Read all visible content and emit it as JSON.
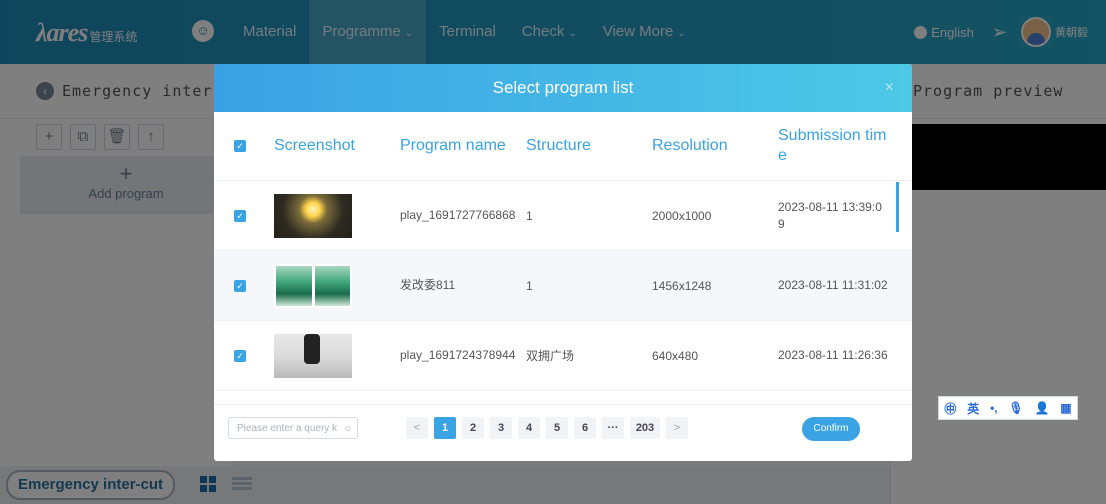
{
  "topbar": {
    "logo_main": "λares",
    "logo_sub": "管理系统",
    "nav": [
      {
        "label": "Material",
        "has_caret": false
      },
      {
        "label": "Programme",
        "has_caret": true
      },
      {
        "label": "Terminal",
        "has_caret": false
      },
      {
        "label": "Check",
        "has_caret": true
      },
      {
        "label": "View More",
        "has_caret": true
      }
    ],
    "language": "English",
    "username": "黄朝毅",
    "accent_color": "#1f8bb8"
  },
  "left_panel": {
    "title": "Emergency inter-",
    "add_program": "Add program"
  },
  "right_panel": {
    "title": "Program preview"
  },
  "bottom_bar": {
    "tab_label": "Emergency inter-cut"
  },
  "modal": {
    "title": "Select program list",
    "close": "×",
    "columns": {
      "screenshot": "Screenshot",
      "program_name": "Program name",
      "structure": "Structure",
      "resolution": "Resolution",
      "submission_time": "Submission time"
    },
    "rows": [
      {
        "name": "play_1691727766868",
        "structure": "1",
        "resolution": "2000x1000",
        "time": "2023-08-11 13:39:09",
        "checked": true,
        "thumb": "sun-icon"
      },
      {
        "name": "发改委811",
        "structure": "1",
        "resolution": "1456x1248",
        "time": "2023-08-11 11:31:02",
        "checked": true,
        "thumb": "poster-icon"
      },
      {
        "name": "play_1691724378944",
        "structure": "双拥广场",
        "resolution": "640x480",
        "time": "2023-08-11 11:26:36",
        "checked": true,
        "thumb": "street-icon"
      }
    ],
    "search_placeholder": "Please enter a query k",
    "pagination": {
      "prev": "<",
      "pages": [
        "1",
        "2",
        "3",
        "4",
        "5",
        "6"
      ],
      "ellipsis": "···",
      "last": "203",
      "next": ">",
      "current": "1"
    },
    "confirm": "Confirm",
    "accent_color": "#3aa3e3"
  },
  "ime_toolbar": {
    "items": [
      "㊥",
      "英",
      "•,",
      "🎙",
      "👤",
      "▦"
    ]
  }
}
